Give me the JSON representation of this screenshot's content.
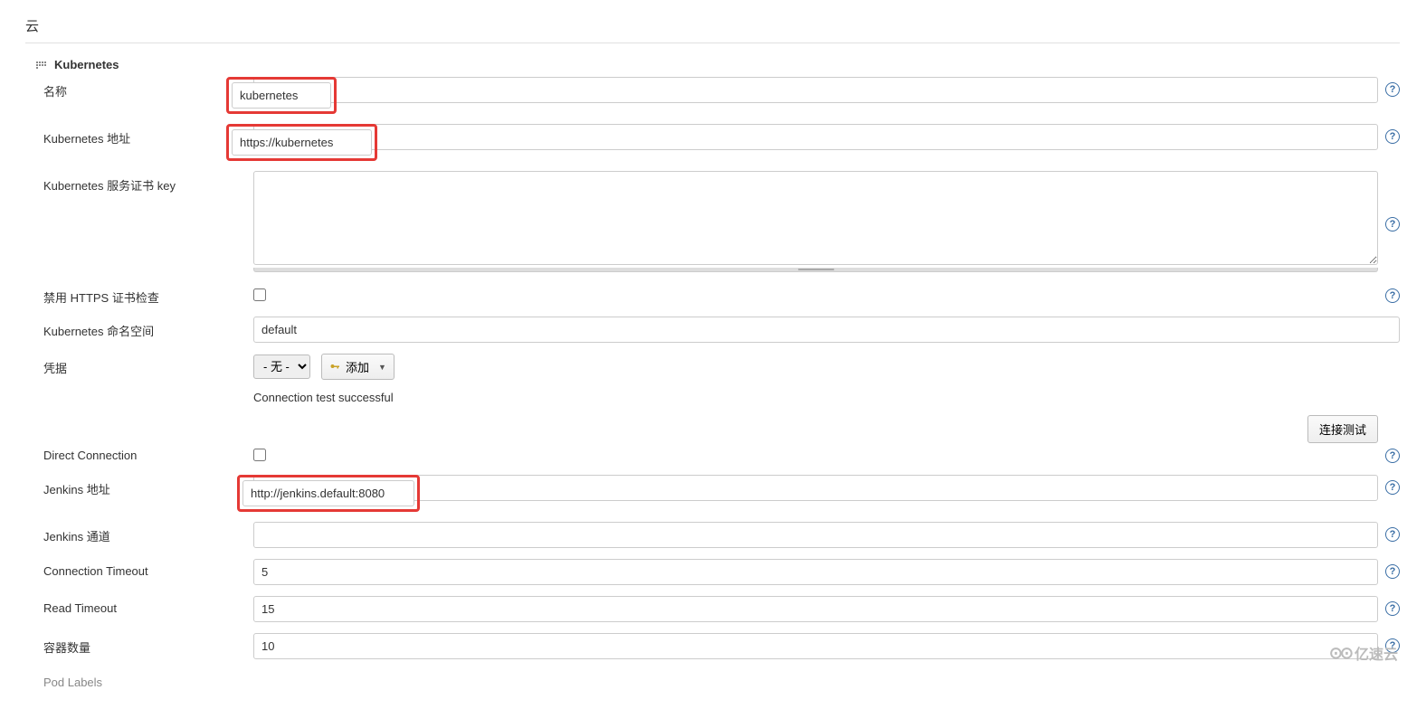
{
  "section": {
    "title": "云"
  },
  "cloud": {
    "title": "Kubernetes"
  },
  "fields": {
    "name": {
      "label": "名称",
      "value": "kubernetes"
    },
    "k8s_url": {
      "label": "Kubernetes 地址",
      "value": "https://kubernetes"
    },
    "cert_key": {
      "label": "Kubernetes 服务证书 key",
      "value": ""
    },
    "disable_https_check": {
      "label": "禁用 HTTPS 证书检查",
      "checked": false
    },
    "namespace": {
      "label": "Kubernetes 命名空间",
      "value": "default"
    },
    "credentials": {
      "label": "凭据",
      "none_option": "- 无 -",
      "add_label": "添加"
    },
    "conn_status": "Connection test successful",
    "test_button": "连接测试",
    "direct_conn": {
      "label": "Direct Connection",
      "checked": false
    },
    "jenkins_url": {
      "label": "Jenkins 地址",
      "value": "http://jenkins.default:8080"
    },
    "jenkins_tunnel": {
      "label": "Jenkins 通道",
      "value": ""
    },
    "conn_timeout": {
      "label": "Connection Timeout",
      "value": "5"
    },
    "read_timeout": {
      "label": "Read Timeout",
      "value": "15"
    },
    "container_cap": {
      "label": "容器数量",
      "value": "10"
    },
    "pod_labels": {
      "label": "Pod Labels"
    }
  },
  "watermark": "亿速云"
}
